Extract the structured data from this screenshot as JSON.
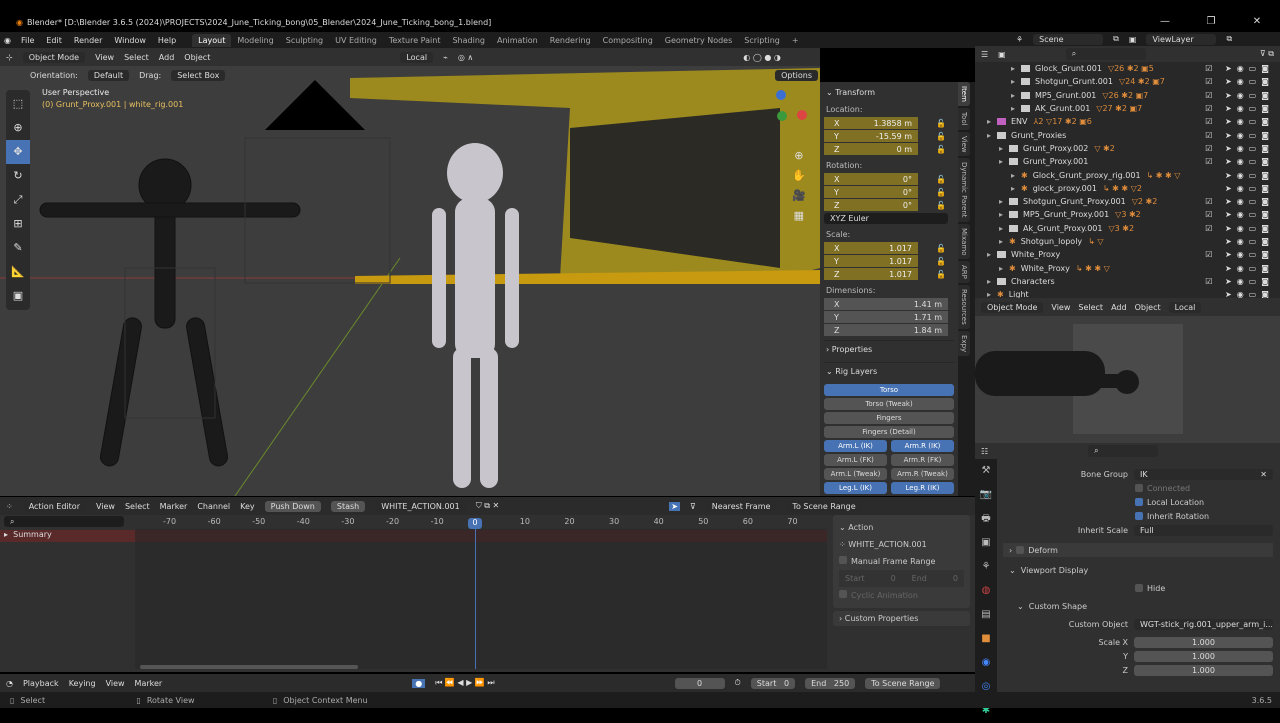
{
  "title": "Blender* [D:\\Blender 3.6.5 (2024)\\PROJECTS\\2024_June_Ticking_bong\\05_Blender\\2024_June_Ticking_bong_1.blend]",
  "menu": [
    "File",
    "Edit",
    "Render",
    "Window",
    "Help"
  ],
  "workspaces": [
    "Layout",
    "Modeling",
    "Sculpting",
    "UV Editing",
    "Texture Paint",
    "Shading",
    "Animation",
    "Rendering",
    "Compositing",
    "Geometry Nodes",
    "Scripting",
    "+"
  ],
  "viewport": {
    "mode": "Object Mode",
    "menus": [
      "View",
      "Select",
      "Add",
      "Object"
    ],
    "pivot": "Local",
    "orientation_label": "Orientation:",
    "orientation": "Default",
    "drag_label": "Drag:",
    "drag": "Select Box",
    "options": "Options",
    "perspective": "User Perspective",
    "object_info": "(0) Grunt_Proxy.001 | white_rig.001"
  },
  "npanel": {
    "transform": "Transform",
    "location": "Location:",
    "loc": [
      [
        "X",
        "1.3858 m"
      ],
      [
        "Y",
        "-15.59 m"
      ],
      [
        "Z",
        "0 m"
      ]
    ],
    "rotation": "Rotation:",
    "rot": [
      [
        "X",
        "0°"
      ],
      [
        "Y",
        "0°"
      ],
      [
        "Z",
        "0°"
      ]
    ],
    "rot_mode": "XYZ Euler",
    "scale": "Scale:",
    "scl": [
      [
        "X",
        "1.017"
      ],
      [
        "Y",
        "1.017"
      ],
      [
        "Z",
        "1.017"
      ]
    ],
    "dimensions": "Dimensions:",
    "dim": [
      [
        "X",
        "1.41 m"
      ],
      [
        "Y",
        "1.71 m"
      ],
      [
        "Z",
        "1.84 m"
      ]
    ],
    "properties": "Properties",
    "rig_layers": "Rig Layers",
    "layers": [
      {
        "l": "Torso",
        "on": true
      }
    ],
    "layers_full": [
      "Torso (Tweak)",
      "Fingers",
      "Fingers (Detail)"
    ],
    "layer_pairs": [
      [
        {
          "l": "Arm.L (IK)",
          "on": true
        },
        {
          "l": "Arm.R (IK)",
          "on": true
        }
      ],
      [
        {
          "l": "Arm.L (FK)",
          "on": false
        },
        {
          "l": "Arm.R (FK)",
          "on": false
        }
      ],
      [
        {
          "l": "Arm.L (Tweak)",
          "on": false
        },
        {
          "l": "Arm.R (Tweak)",
          "on": false
        }
      ],
      [
        {
          "l": "Leg.L (IK)",
          "on": true
        },
        {
          "l": "Leg.R (IK)",
          "on": true
        }
      ]
    ],
    "tabs": [
      "Item",
      "Tool",
      "View",
      "Dynamic Parent",
      "Mixamo",
      "ARP",
      "Resources",
      "Expy"
    ]
  },
  "topbar": {
    "scene": "Scene",
    "view_layer": "ViewLayer"
  },
  "outliner": [
    {
      "d": 3,
      "n": "Glock_Grunt.001",
      "b": "▽26 ✱2 ▣5",
      "c": true
    },
    {
      "d": 3,
      "n": "Shotgun_Grunt.001",
      "b": "▽24 ✱2 ▣7",
      "c": true
    },
    {
      "d": 3,
      "n": "MP5_Grunt.001",
      "b": "▽26 ✱2 ▣7",
      "c": true
    },
    {
      "d": 3,
      "n": "AK_Grunt.001",
      "b": "▽27 ✱2 ▣7",
      "c": true
    },
    {
      "d": 1,
      "n": "ENV",
      "b": "⅄2 ▽17 ✱2 ▣6",
      "c": true,
      "pink": true
    },
    {
      "d": 1,
      "n": "Grunt_Proxies",
      "b": "",
      "c": true
    },
    {
      "d": 2,
      "n": "Grunt_Proxy.002",
      "b": "▽ ✱2",
      "c": true
    },
    {
      "d": 2,
      "n": "Grunt_Proxy.001",
      "b": "",
      "c": true
    },
    {
      "d": 3,
      "n": "Glock_Grunt_proxy_rig.001",
      "b": "↳ ✱ ✱ ▽",
      "c": false,
      "obj": true
    },
    {
      "d": 3,
      "n": "glock_proxy.001",
      "b": "↳ ✱ ✱ ▽2",
      "c": false,
      "obj": true
    },
    {
      "d": 2,
      "n": "Shotgun_Grunt_Proxy.001",
      "b": "▽2 ✱2",
      "c": true
    },
    {
      "d": 2,
      "n": "MP5_Grunt_Proxy.001",
      "b": "▽3 ✱2",
      "c": true
    },
    {
      "d": 2,
      "n": "Ak_Grunt_Proxy.001",
      "b": "▽3 ✱2",
      "c": true
    },
    {
      "d": 2,
      "n": "Shotgun_lopoly",
      "b": "↳ ▽",
      "c": false,
      "obj": true
    },
    {
      "d": 1,
      "n": "White_Proxy",
      "b": "",
      "c": true
    },
    {
      "d": 2,
      "n": "White_Proxy",
      "b": "↳ ✱ ✱ ▽",
      "c": false,
      "obj": true
    },
    {
      "d": 1,
      "n": "Characters",
      "b": "",
      "c": true
    },
    {
      "d": 1,
      "n": "Light",
      "b": "",
      "c": false,
      "obj": true
    }
  ],
  "preview": {
    "mode": "Object Mode",
    "menus": [
      "View",
      "Select",
      "Add",
      "Object"
    ],
    "pivot": "Local"
  },
  "props": {
    "bone_group_label": "Bone Group",
    "bone_group": "IK",
    "connected": "Connected",
    "local_location": "Local Location",
    "inherit_rotation": "Inherit Rotation",
    "inherit_scale_label": "Inherit Scale",
    "inherit_scale": "Full",
    "deform": "Deform",
    "viewport_display": "Viewport Display",
    "hide": "Hide",
    "custom_shape": "Custom Shape",
    "custom_object_label": "Custom Object",
    "custom_object": "WGT-stick_rig.001_upper_arm_i...",
    "scale_x_label": "Scale X",
    "y_label": "Y",
    "z_label": "Z",
    "scale": [
      "1.000",
      "1.000",
      "1.000"
    ],
    "version": "3.6.5"
  },
  "action": {
    "editor": "Action Editor",
    "menus": [
      "View",
      "Select",
      "Marker",
      "Channel",
      "Key"
    ],
    "push_down": "Push Down",
    "stash": "Stash",
    "action_name": "WHITE_ACTION.001",
    "snap": "Nearest Frame",
    "to_scene_range": "To Scene Range",
    "ticks": [
      "-70",
      "-60",
      "-50",
      "-40",
      "-30",
      "-20",
      "-10",
      "0",
      "10",
      "20",
      "30",
      "40",
      "50",
      "60",
      "70"
    ],
    "current_frame": "0",
    "summary": "Summary",
    "side": {
      "title": "Action",
      "name": "WHITE_ACTION.001",
      "manual": "Manual Frame Range",
      "start_label": "Start",
      "start": "0",
      "end_label": "End",
      "end": "0",
      "cyclic": "Cyclic Animation",
      "custom_props": "Custom Properties"
    }
  },
  "timeline": {
    "menus": [
      "Playback",
      "Keying",
      "View",
      "Marker"
    ],
    "frame": "0",
    "start_label": "Start",
    "start": "0",
    "end_label": "End",
    "end": "250",
    "to_scene_range": "To Scene Range"
  },
  "status": {
    "select": "Select",
    "rotate": "Rotate View",
    "context": "Object Context Menu"
  }
}
